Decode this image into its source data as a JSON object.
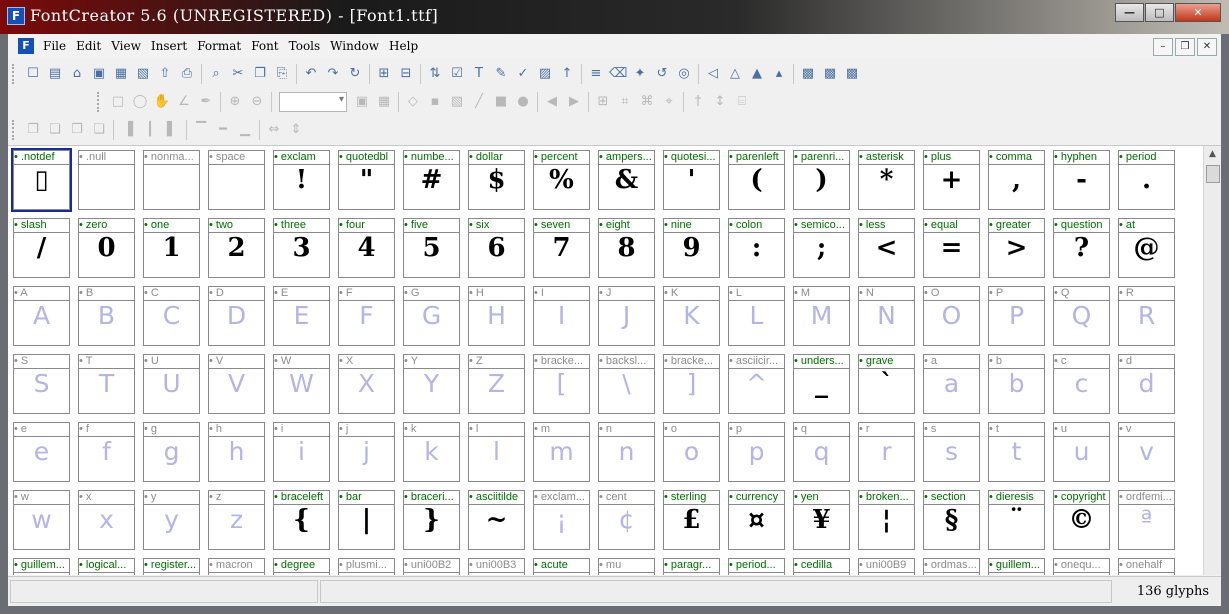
{
  "window": {
    "title": "FontCreator 5.6 (UNREGISTERED) - [Font1.ttf]",
    "app_icon": "F",
    "buttons": [
      "—",
      "□",
      "✕"
    ]
  },
  "menubar": {
    "items": [
      "File",
      "Edit",
      "View",
      "Insert",
      "Format",
      "Font",
      "Tools",
      "Window",
      "Help"
    ],
    "mdi_buttons": [
      "–",
      "❒",
      "✕"
    ]
  },
  "toolbar": {
    "row1": [
      "new-file-icon",
      "open-file-icon",
      "open-folder-icon",
      "save-icon",
      "save-all-icon",
      "copy-doc-icon",
      "export-icon",
      "print-icon",
      "find-icon",
      "cut-icon",
      "copy-icon",
      "paste-icon",
      "undo-icon",
      "redo-icon",
      "refresh-icon",
      "add-glyph-icon",
      "add-glyph-range-icon",
      "sort-icon",
      "properties-icon",
      "text-icon",
      "script-icon",
      "validate-icon",
      "preview-icon",
      "install-icon",
      "list-icon",
      "erase-icon",
      "transform-icon",
      "rotate-icon",
      "test-icon",
      "align-left-icon",
      "align-center-icon",
      "skew-icon",
      "skew2-icon",
      "layer1-icon",
      "layer2-icon",
      "layer3-icon"
    ],
    "row2": [
      "select-icon",
      "lasso-icon",
      "hand-icon",
      "measure-icon",
      "pen-icon",
      "zoom-in-icon",
      "zoom-out-icon",
      "zoom-fit-icon",
      "grid-icon",
      "contour-icon",
      "point-icon",
      "image-icon",
      "line-icon",
      "rect-icon",
      "ellipse-icon",
      "prev-icon",
      "next-icon",
      "table-icon",
      "snap-icon",
      "guides-icon",
      "metrics-icon",
      "hint-icon",
      "kern-icon",
      "map-icon"
    ],
    "row3": [
      "combine-icon",
      "union-icon",
      "intersect-icon",
      "subtract-icon",
      "align-l-icon",
      "align-c-icon",
      "align-r-icon",
      "align-t-icon",
      "align-m-icon",
      "align-b-icon",
      "dist-h-icon",
      "dist-v-icon"
    ]
  },
  "glyphs": [
    {
      "name": ".notdef",
      "char": "▯",
      "defined": true
    },
    {
      "name": ".null",
      "char": "",
      "defined": false
    },
    {
      "name": "nonma...",
      "char": "",
      "defined": false
    },
    {
      "name": "space",
      "char": "",
      "defined": false
    },
    {
      "name": "exclam",
      "char": "!",
      "defined": true
    },
    {
      "name": "quotedbl",
      "char": "\"",
      "defined": true
    },
    {
      "name": "numbe...",
      "char": "#",
      "defined": true
    },
    {
      "name": "dollar",
      "char": "$",
      "defined": true
    },
    {
      "name": "percent",
      "char": "%",
      "defined": true
    },
    {
      "name": "ampers...",
      "char": "&",
      "defined": true
    },
    {
      "name": "quotesi...",
      "char": "'",
      "defined": true
    },
    {
      "name": "parenleft",
      "char": "(",
      "defined": true
    },
    {
      "name": "parenri...",
      "char": ")",
      "defined": true
    },
    {
      "name": "asterisk",
      "char": "*",
      "defined": true
    },
    {
      "name": "plus",
      "char": "+",
      "defined": true
    },
    {
      "name": "comma",
      "char": ",",
      "defined": true
    },
    {
      "name": "hyphen",
      "char": "-",
      "defined": true
    },
    {
      "name": "period",
      "char": ".",
      "defined": true
    },
    {
      "name": "slash",
      "char": "/",
      "defined": true
    },
    {
      "name": "zero",
      "char": "0",
      "defined": true
    },
    {
      "name": "one",
      "char": "1",
      "defined": true
    },
    {
      "name": "two",
      "char": "2",
      "defined": true
    },
    {
      "name": "three",
      "char": "3",
      "defined": true
    },
    {
      "name": "four",
      "char": "4",
      "defined": true
    },
    {
      "name": "five",
      "char": "5",
      "defined": true
    },
    {
      "name": "six",
      "char": "6",
      "defined": true
    },
    {
      "name": "seven",
      "char": "7",
      "defined": true
    },
    {
      "name": "eight",
      "char": "8",
      "defined": true
    },
    {
      "name": "nine",
      "char": "9",
      "defined": true
    },
    {
      "name": "colon",
      "char": ":",
      "defined": true
    },
    {
      "name": "semico...",
      "char": ";",
      "defined": true
    },
    {
      "name": "less",
      "char": "<",
      "defined": true
    },
    {
      "name": "equal",
      "char": "=",
      "defined": true
    },
    {
      "name": "greater",
      "char": ">",
      "defined": true
    },
    {
      "name": "question",
      "char": "?",
      "defined": true
    },
    {
      "name": "at",
      "char": "@",
      "defined": true
    },
    {
      "name": "A",
      "char": "A",
      "defined": false
    },
    {
      "name": "B",
      "char": "B",
      "defined": false
    },
    {
      "name": "C",
      "char": "C",
      "defined": false
    },
    {
      "name": "D",
      "char": "D",
      "defined": false
    },
    {
      "name": "E",
      "char": "E",
      "defined": false
    },
    {
      "name": "F",
      "char": "F",
      "defined": false
    },
    {
      "name": "G",
      "char": "G",
      "defined": false
    },
    {
      "name": "H",
      "char": "H",
      "defined": false
    },
    {
      "name": "I",
      "char": "I",
      "defined": false
    },
    {
      "name": "J",
      "char": "J",
      "defined": false
    },
    {
      "name": "K",
      "char": "K",
      "defined": false
    },
    {
      "name": "L",
      "char": "L",
      "defined": false
    },
    {
      "name": "M",
      "char": "M",
      "defined": false
    },
    {
      "name": "N",
      "char": "N",
      "defined": false
    },
    {
      "name": "O",
      "char": "O",
      "defined": false
    },
    {
      "name": "P",
      "char": "P",
      "defined": false
    },
    {
      "name": "Q",
      "char": "Q",
      "defined": false
    },
    {
      "name": "R",
      "char": "R",
      "defined": false
    },
    {
      "name": "S",
      "char": "S",
      "defined": false
    },
    {
      "name": "T",
      "char": "T",
      "defined": false
    },
    {
      "name": "U",
      "char": "U",
      "defined": false
    },
    {
      "name": "V",
      "char": "V",
      "defined": false
    },
    {
      "name": "W",
      "char": "W",
      "defined": false
    },
    {
      "name": "X",
      "char": "X",
      "defined": false
    },
    {
      "name": "Y",
      "char": "Y",
      "defined": false
    },
    {
      "name": "Z",
      "char": "Z",
      "defined": false
    },
    {
      "name": "bracke...",
      "char": "[",
      "defined": false
    },
    {
      "name": "backsl...",
      "char": "\\",
      "defined": false
    },
    {
      "name": "bracke...",
      "char": "]",
      "defined": false
    },
    {
      "name": "asciicir...",
      "char": "^",
      "defined": false
    },
    {
      "name": "unders...",
      "char": "_",
      "defined": true
    },
    {
      "name": "grave",
      "char": "`",
      "defined": true
    },
    {
      "name": "a",
      "char": "a",
      "defined": false
    },
    {
      "name": "b",
      "char": "b",
      "defined": false
    },
    {
      "name": "c",
      "char": "c",
      "defined": false
    },
    {
      "name": "d",
      "char": "d",
      "defined": false
    },
    {
      "name": "e",
      "char": "e",
      "defined": false
    },
    {
      "name": "f",
      "char": "f",
      "defined": false
    },
    {
      "name": "g",
      "char": "g",
      "defined": false
    },
    {
      "name": "h",
      "char": "h",
      "defined": false
    },
    {
      "name": "i",
      "char": "i",
      "defined": false
    },
    {
      "name": "j",
      "char": "j",
      "defined": false
    },
    {
      "name": "k",
      "char": "k",
      "defined": false
    },
    {
      "name": "l",
      "char": "l",
      "defined": false
    },
    {
      "name": "m",
      "char": "m",
      "defined": false
    },
    {
      "name": "n",
      "char": "n",
      "defined": false
    },
    {
      "name": "o",
      "char": "o",
      "defined": false
    },
    {
      "name": "p",
      "char": "p",
      "defined": false
    },
    {
      "name": "q",
      "char": "q",
      "defined": false
    },
    {
      "name": "r",
      "char": "r",
      "defined": false
    },
    {
      "name": "s",
      "char": "s",
      "defined": false
    },
    {
      "name": "t",
      "char": "t",
      "defined": false
    },
    {
      "name": "u",
      "char": "u",
      "defined": false
    },
    {
      "name": "v",
      "char": "v",
      "defined": false
    },
    {
      "name": "w",
      "char": "w",
      "defined": false
    },
    {
      "name": "x",
      "char": "x",
      "defined": false
    },
    {
      "name": "y",
      "char": "y",
      "defined": false
    },
    {
      "name": "z",
      "char": "z",
      "defined": false
    },
    {
      "name": "braceleft",
      "char": "{",
      "defined": true
    },
    {
      "name": "bar",
      "char": "|",
      "defined": true
    },
    {
      "name": "braceri...",
      "char": "}",
      "defined": true
    },
    {
      "name": "asciitilde",
      "char": "~",
      "defined": true
    },
    {
      "name": "exclam...",
      "char": "¡",
      "defined": false
    },
    {
      "name": "cent",
      "char": "¢",
      "defined": false
    },
    {
      "name": "sterling",
      "char": "£",
      "defined": true
    },
    {
      "name": "currency",
      "char": "¤",
      "defined": true
    },
    {
      "name": "yen",
      "char": "¥",
      "defined": true
    },
    {
      "name": "broken...",
      "char": "¦",
      "defined": true
    },
    {
      "name": "section",
      "char": "§",
      "defined": true
    },
    {
      "name": "dieresis",
      "char": "¨",
      "defined": true
    },
    {
      "name": "copyright",
      "char": "©",
      "defined": true
    },
    {
      "name": "ordfemi...",
      "char": "ª",
      "defined": false
    },
    {
      "name": "guillem...",
      "char": "",
      "defined": true
    },
    {
      "name": "logical...",
      "char": "",
      "defined": true
    },
    {
      "name": "register...",
      "char": "",
      "defined": true
    },
    {
      "name": "macron",
      "char": "",
      "defined": false
    },
    {
      "name": "degree",
      "char": "",
      "defined": true
    },
    {
      "name": "plusmi...",
      "char": "",
      "defined": false
    },
    {
      "name": "uni00B2",
      "char": "",
      "defined": false
    },
    {
      "name": "uni00B3",
      "char": "",
      "defined": false
    },
    {
      "name": "acute",
      "char": "",
      "defined": true
    },
    {
      "name": "mu",
      "char": "",
      "defined": false
    },
    {
      "name": "paragr...",
      "char": "",
      "defined": true
    },
    {
      "name": "period...",
      "char": "",
      "defined": true
    },
    {
      "name": "cedilla",
      "char": "",
      "defined": true
    },
    {
      "name": "uni00B9",
      "char": "",
      "defined": false
    },
    {
      "name": "ordmas...",
      "char": "",
      "defined": false
    },
    {
      "name": "guillem...",
      "char": "",
      "defined": true
    },
    {
      "name": "onequ...",
      "char": "",
      "defined": false
    },
    {
      "name": "onehalf",
      "char": "",
      "defined": false
    }
  ],
  "selected_index": 0,
  "status": {
    "glyph_count": "136 glyphs"
  },
  "colors": {
    "defined_label": "#007000",
    "undefined_label": "#8c8c8c",
    "undefined_glyph": "#b4b4e6",
    "selection": "#1a2a98"
  }
}
